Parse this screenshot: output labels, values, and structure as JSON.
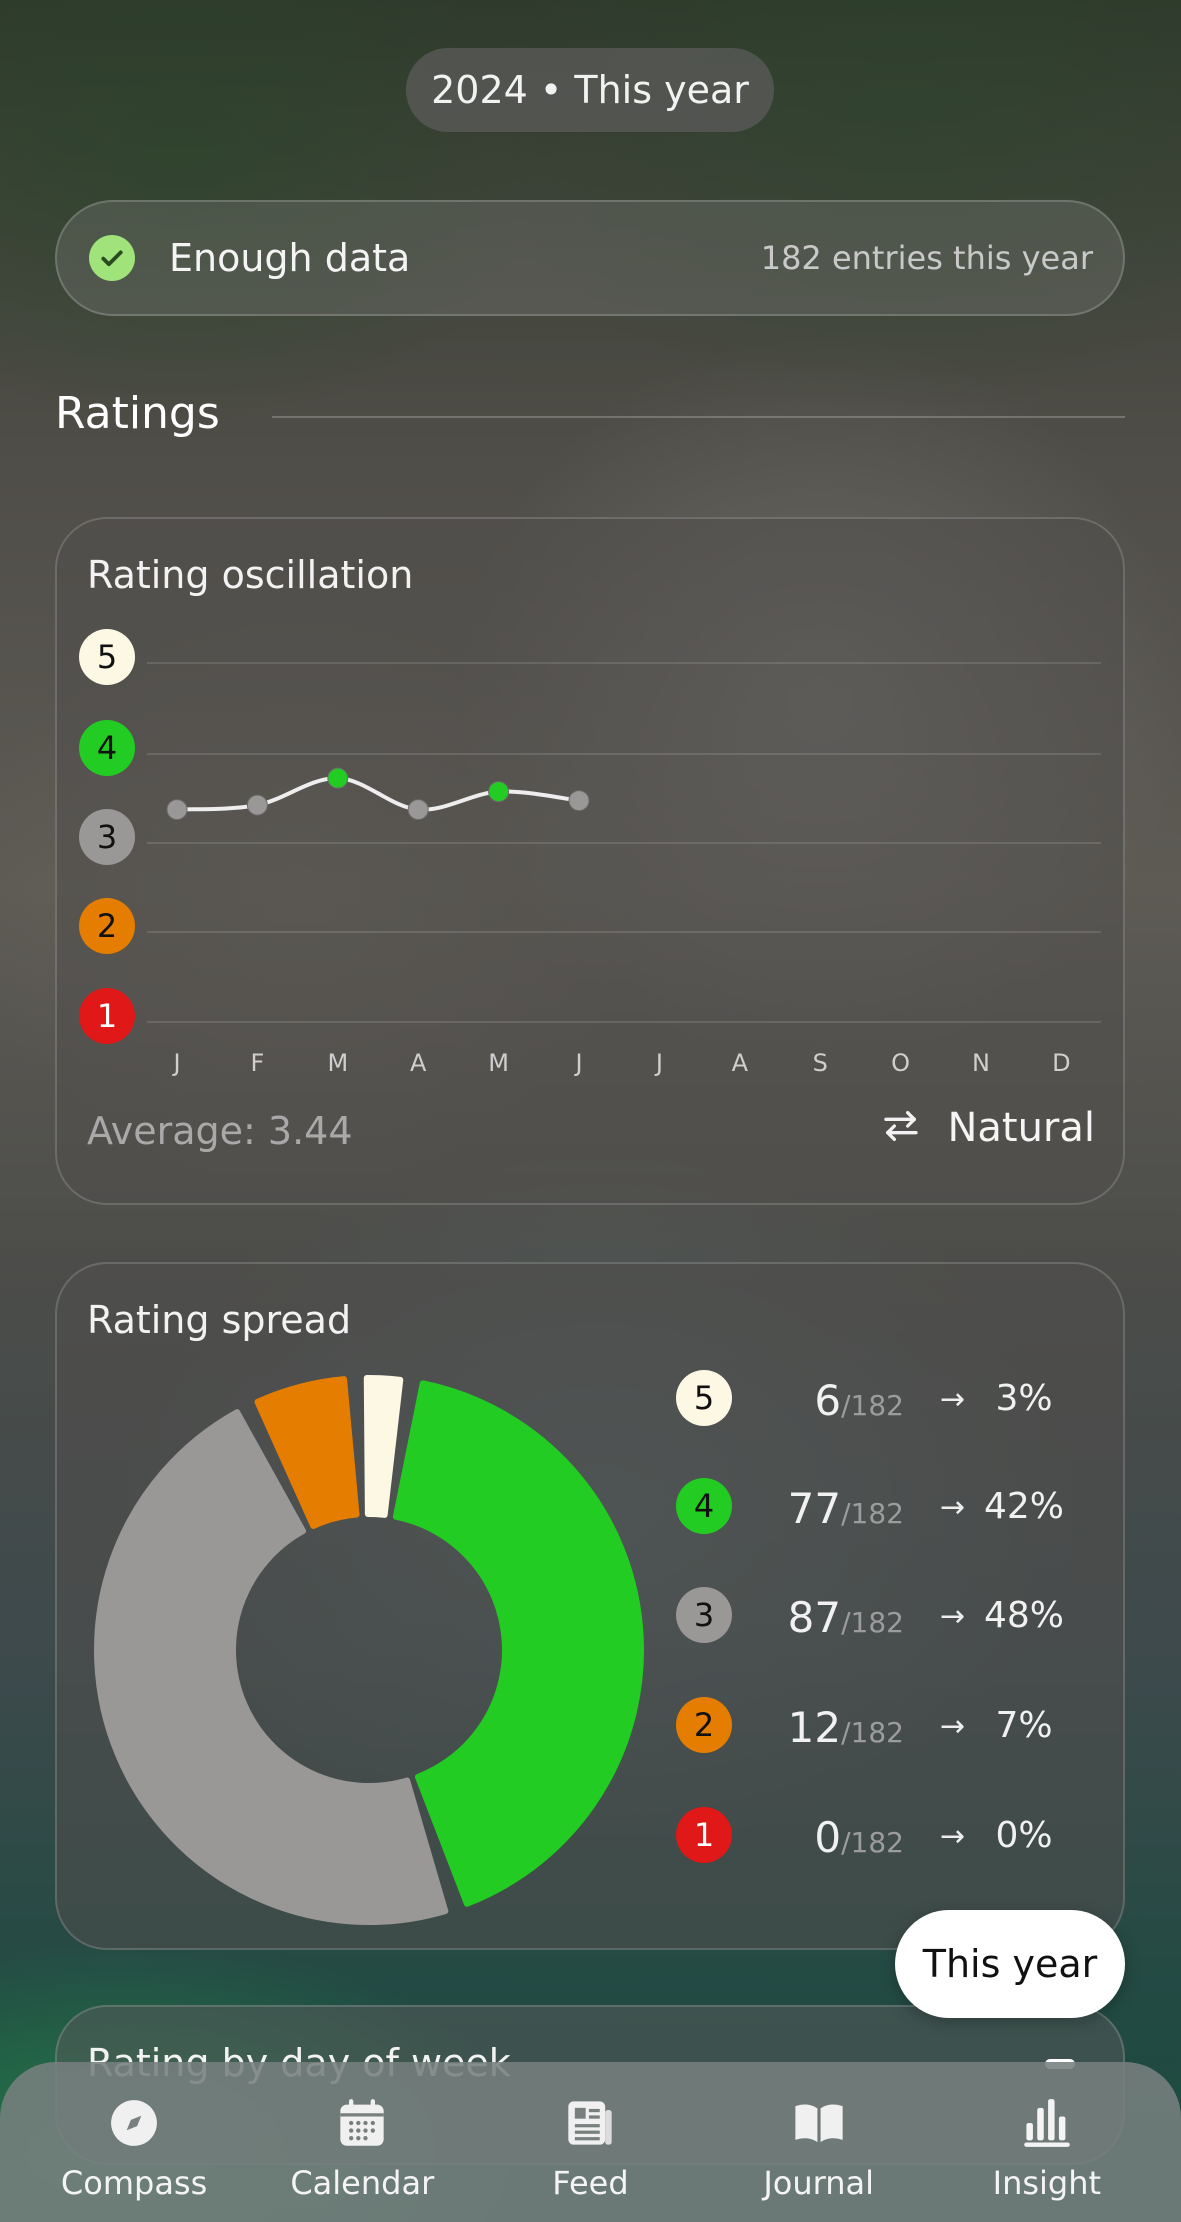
{
  "header": {
    "year_pill": "2024 • This year"
  },
  "status": {
    "label": "Enough data",
    "count": "182 entries this year",
    "icon": "check-icon"
  },
  "section": {
    "title": "Ratings"
  },
  "oscillation": {
    "title": "Rating oscillation",
    "levels": [
      {
        "value": "5",
        "color": "#fdf8e4",
        "text_color": "#111111"
      },
      {
        "value": "4",
        "color": "#22cc22",
        "text_color": "#111111"
      },
      {
        "value": "3",
        "color": "#9a9896",
        "text_color": "#111111"
      },
      {
        "value": "2",
        "color": "#e57d00",
        "text_color": "#111111"
      },
      {
        "value": "1",
        "color": "#e01818",
        "text_color": "#ffffff"
      }
    ],
    "months": [
      "J",
      "F",
      "M",
      "A",
      "M",
      "J",
      "J",
      "A",
      "S",
      "O",
      "N",
      "D"
    ],
    "average": "Average: 3.44",
    "mode_label": "Natural",
    "mode_icon": "swap-arrows-icon"
  },
  "spread": {
    "title": "Rating spread",
    "rows": [
      {
        "rating": "5",
        "count": "6",
        "total": "/182",
        "pct": "3%",
        "color": "#fdf8e4",
        "text_color": "#111111"
      },
      {
        "rating": "4",
        "count": "77",
        "total": "/182",
        "pct": "42%",
        "color": "#22cc22",
        "text_color": "#111111"
      },
      {
        "rating": "3",
        "count": "87",
        "total": "/182",
        "pct": "48%",
        "color": "#9a9896",
        "text_color": "#111111"
      },
      {
        "rating": "2",
        "count": "12",
        "total": "/182",
        "pct": "7%",
        "color": "#e57d00",
        "text_color": "#111111"
      },
      {
        "rating": "1",
        "count": "0",
        "total": "/182",
        "pct": "0%",
        "color": "#e01818",
        "text_color": "#ffffff"
      }
    ]
  },
  "float_pill": {
    "label": "This year"
  },
  "peek_card": {
    "title": "Rating by day of week"
  },
  "nav": {
    "items": [
      {
        "label": "Compass",
        "icon": "compass-icon"
      },
      {
        "label": "Calendar",
        "icon": "calendar-icon"
      },
      {
        "label": "Feed",
        "icon": "feed-icon"
      },
      {
        "label": "Journal",
        "icon": "journal-icon"
      },
      {
        "label": "Insight",
        "icon": "insight-icon"
      }
    ]
  },
  "chart_data": [
    {
      "type": "line",
      "title": "Rating oscillation",
      "x": [
        "J",
        "F",
        "M",
        "A",
        "M",
        "J"
      ],
      "categories": [
        "J",
        "F",
        "M",
        "A",
        "M",
        "J",
        "J",
        "A",
        "S",
        "O",
        "N",
        "D"
      ],
      "series": [
        {
          "values": [
            3.3,
            3.35,
            3.65,
            3.3,
            3.5,
            3.4
          ]
        }
      ],
      "ylim": [
        1,
        5
      ],
      "yticks": [
        1,
        2,
        3,
        4,
        5
      ],
      "grid": true
    },
    {
      "type": "pie",
      "title": "Rating spread",
      "categories": [
        "5",
        "4",
        "3",
        "2",
        "1"
      ],
      "values": [
        6,
        77,
        87,
        12,
        0
      ],
      "colors": [
        "#fdf8e4",
        "#22cc22",
        "#9a9896",
        "#e57d00",
        "#e01818"
      ],
      "total": 182
    }
  ]
}
